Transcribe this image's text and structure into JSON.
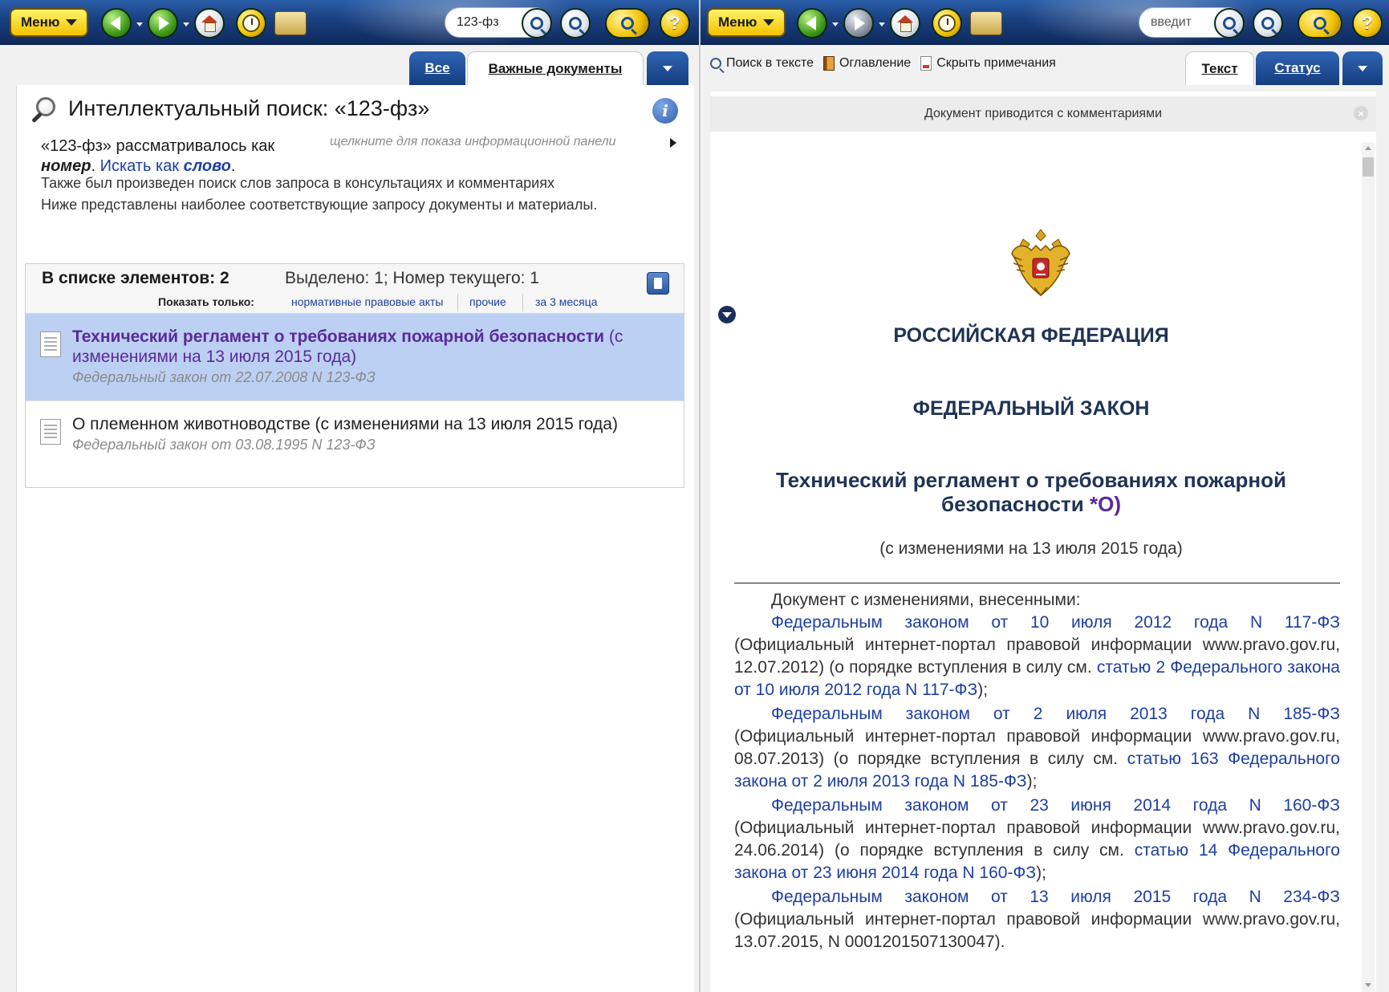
{
  "left": {
    "toolbar": {
      "menu_label": "Меню",
      "search_value": "123-фз"
    },
    "tabs": {
      "all_label": "Все",
      "important_label": "Важные документы"
    },
    "search": {
      "title": "Интеллектуальный поиск: «123-фз»",
      "considered_prefix": "«123-фз» рассматривалось как",
      "considered_as": "номер",
      "search_as_prefix": "Искать как",
      "search_as_word": "слово",
      "panel_hint": "щелкните для показа информационной панели",
      "also_searched": "Также был произведен поиск слов запроса в консультациях и комментариях",
      "below_shown": "Ниже представлены наиболее соответствующие запросу документы и материалы."
    },
    "list": {
      "count_label": "В списке элементов: 2",
      "selection_info": "Выделено: 1; Номер текущего: 1",
      "show_only_label": "Показать только:",
      "filters": [
        "нормативные правовые акты",
        "прочие",
        "за 3 месяца"
      ],
      "items": [
        {
          "title_bold": "Технический регламент о требованиях пожарной безопасности",
          "title_rest": " (с изменениями на 13 июля 2015 года)",
          "subtitle": "Федеральный закон от 22.07.2008 N 123-ФЗ"
        },
        {
          "title_bold": "",
          "title_rest": "О племенном животноводстве (с изменениями на 13 июля 2015 года)",
          "subtitle": "Федеральный закон от 03.08.1995 N 123-ФЗ"
        }
      ]
    }
  },
  "right": {
    "toolbar": {
      "menu_label": "Меню",
      "search_value": "введит"
    },
    "tools": {
      "search_in_text": "Поиск в тексте",
      "contents": "Оглавление",
      "hide_notes": "Скрыть примечания"
    },
    "tabs": {
      "text_label": "Текст",
      "status_label": "Статус"
    },
    "notice": "Документ приводится с комментариями",
    "document": {
      "country": "РОССИЙСКАЯ ФЕДЕРАЦИЯ",
      "law_type": "ФЕДЕРАЛЬНЫЙ ЗАКОН",
      "title": "Технический регламент о требованиях пожарной безопасности",
      "title_mark": "*О)",
      "changes": "(с изменениями на 13 июля 2015 года)",
      "intro": "Документ с изменениями, внесенными:",
      "amendments": [
        {
          "lead": "Федеральным законом от 10 июля 2012 года N 117-ФЗ",
          "body": "(Официальный интернет-портал правовой информации www.pravo.gov.ru, 12.07.2012) (о порядке вступления в силу см.",
          "link": "статью 2 Федерального закона от 10 июля 2012 года N 117-ФЗ",
          "end": ");"
        },
        {
          "lead": "Федеральным законом от 2 июля 2013 года N 185-ФЗ",
          "body": "(Официальный интернет-портал правовой информации www.pravo.gov.ru, 08.07.2013) (о порядке вступления в силу см.",
          "link": "статью 163 Федерального закона от 2 июля 2013 года N 185-ФЗ",
          "end": ");"
        },
        {
          "lead": "Федеральным законом от 23 июня 2014 года N 160-ФЗ",
          "body": "(Официальный интернет-портал правовой информации www.pravo.gov.ru, 24.06.2014) (о порядке вступления в силу см.",
          "link": "статью 14 Федерального закона от 23 июня 2014 года N 160-ФЗ",
          "end": ");"
        },
        {
          "lead": "Федеральным законом от 13 июля 2015 года N 234-ФЗ",
          "body": "(Официальный интернет-портал правовой информации www.pravo.gov.ru, 13.07.2015, N 0001201507130047).",
          "link": "",
          "end": ""
        }
      ]
    }
  }
}
